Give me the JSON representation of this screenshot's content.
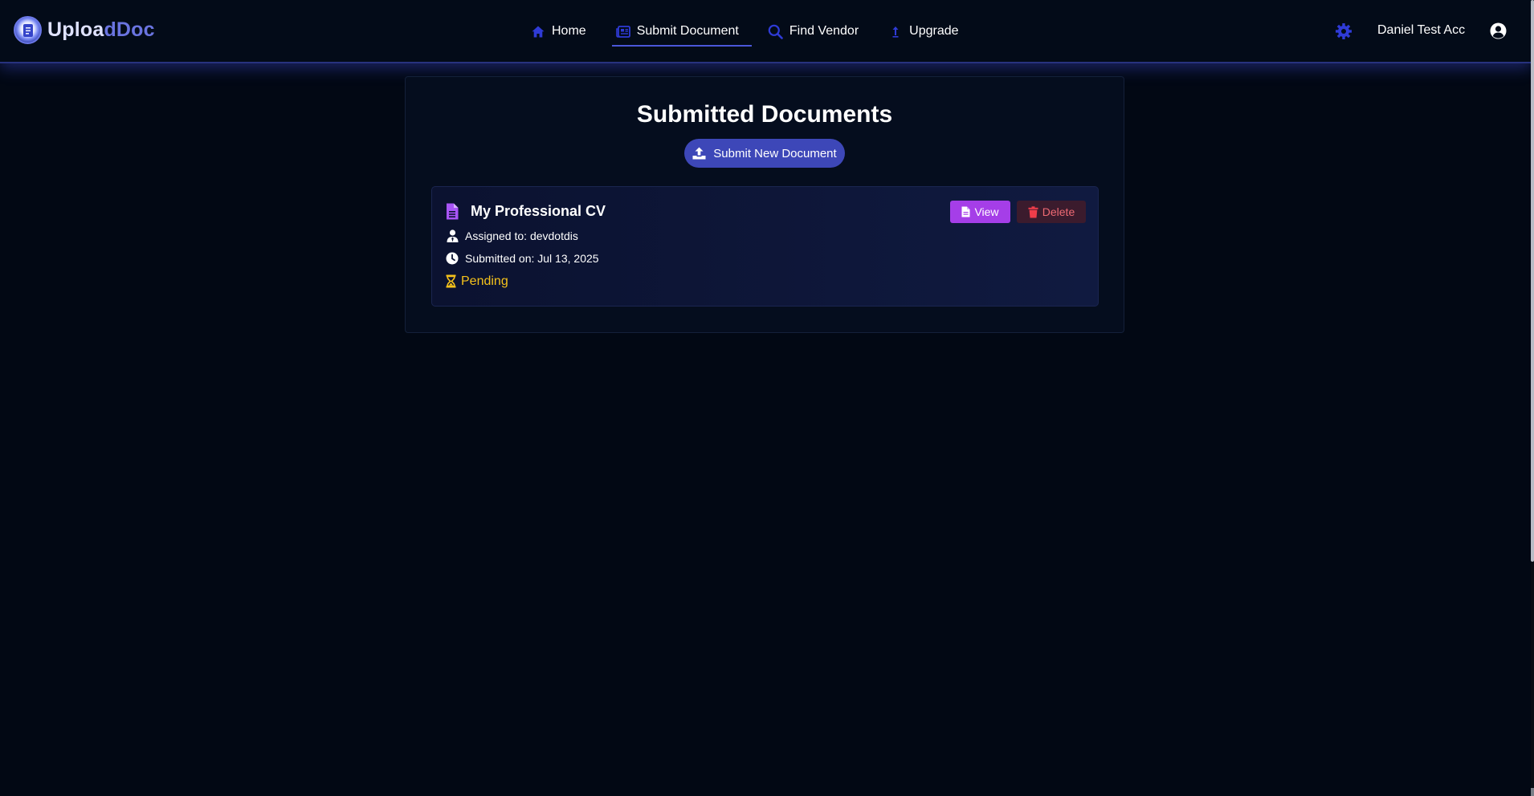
{
  "brand": {
    "name_part1": "Uploa",
    "name_part2": "dDoc",
    "logo_icon": "document-logo-icon"
  },
  "nav": {
    "items": [
      {
        "label": "Home",
        "icon": "home-icon",
        "active": false
      },
      {
        "label": "Submit Document",
        "icon": "newspaper-icon",
        "active": true
      },
      {
        "label": "Find Vendor",
        "icon": "search-icon",
        "active": false
      },
      {
        "label": "Upgrade",
        "icon": "arrow-up-icon",
        "active": false
      }
    ]
  },
  "header": {
    "user_name": "Daniel Test Acc",
    "settings_icon": "gear-icon",
    "profile_icon": "user-circle-icon"
  },
  "main": {
    "title": "Submitted Documents",
    "submit_button_label": "Submit New Document"
  },
  "documents": [
    {
      "title": "My Professional CV",
      "assigned": "Assigned to: devdotdis",
      "submitted": "Submitted on: Jul 13, 2025",
      "status": "Pending",
      "view_label": "View",
      "delete_label": "Delete"
    }
  ],
  "colors": {
    "accent": "#3d47b8",
    "view_button": "#a53ee8",
    "delete_text": "#ef6a74",
    "pending": "#f5c21b",
    "icon_blue": "#2f3bd6"
  }
}
